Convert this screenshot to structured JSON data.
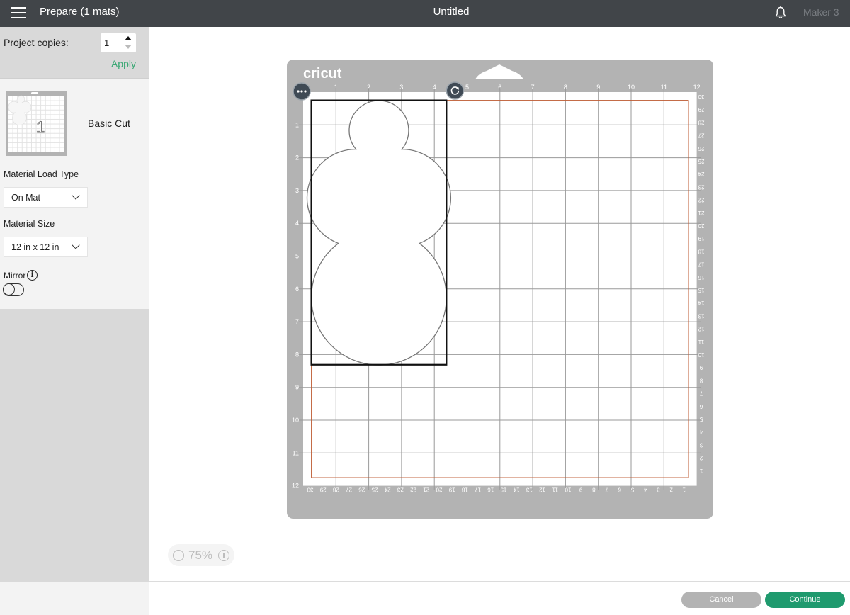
{
  "topbar": {
    "menu_icon": "hamburger-menu-icon",
    "title": "Prepare (1 mats)",
    "document_title": "Untitled",
    "notification_icon": "bell-icon",
    "machine": "Maker 3"
  },
  "sidebar": {
    "project_copies_label": "Project copies:",
    "project_copies_value": "1",
    "apply_label": "Apply",
    "mat": {
      "number": "1",
      "name": "Basic Cut"
    },
    "material_load_type_label": "Material Load Type",
    "material_load_type_value": "On Mat",
    "material_size_label": "Material Size",
    "material_size_value": "12 in x 12 in",
    "mirror_label": "Mirror",
    "mirror_on": false
  },
  "mat": {
    "brand": "cricut",
    "inch_ticks_top": [
      "1",
      "2",
      "3",
      "4",
      "5",
      "6",
      "7",
      "8",
      "9",
      "10",
      "11",
      "12"
    ],
    "inch_ticks_left": [
      "1",
      "2",
      "3",
      "4",
      "5",
      "6",
      "7",
      "8",
      "9",
      "10",
      "11",
      "12"
    ],
    "cm_ticks_right": [
      "30",
      "29",
      "28",
      "27",
      "26",
      "25",
      "24",
      "23",
      "22",
      "21",
      "20",
      "19",
      "18",
      "17",
      "16",
      "15",
      "14",
      "13",
      "12",
      "11",
      "10",
      "9",
      "8",
      "7",
      "6",
      "5",
      "4",
      "3",
      "2",
      "1"
    ],
    "cm_ticks_bottom": [
      "30",
      "29",
      "28",
      "27",
      "26",
      "25",
      "24",
      "23",
      "22",
      "21",
      "20",
      "19",
      "18",
      "17",
      "16",
      "15",
      "14",
      "13",
      "12",
      "11",
      "10",
      "9",
      "8",
      "7",
      "6",
      "5",
      "4",
      "3",
      "2",
      "1"
    ],
    "more_icon": "more-options-icon",
    "rotate_icon": "rotate-icon",
    "design": {
      "shape": "snowman",
      "x_in": 0.25,
      "y_in": 0.25,
      "width_in": 4.12,
      "height_in": 8.06
    },
    "colors": {
      "mat": "#b3b3b3",
      "grid": "#9a9a9a",
      "cut_boundary": "#c0603a",
      "selection": "#111111"
    }
  },
  "zoom": {
    "value": "75%"
  },
  "footer": {
    "cancel_label": "Cancel",
    "continue_label": "Continue",
    "accent": "#1f9a6e"
  }
}
